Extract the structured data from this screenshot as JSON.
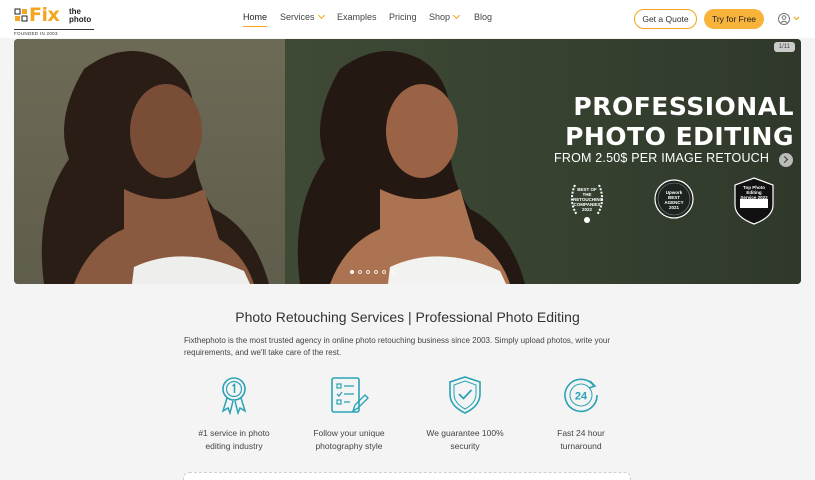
{
  "logo": {
    "fix": "Fix",
    "the": "the",
    "photo": "photo",
    "founded": "FOUNDED IN 2003"
  },
  "nav": [
    {
      "label": "Home",
      "dropdown": false
    },
    {
      "label": "Services",
      "dropdown": true
    },
    {
      "label": "Examples",
      "dropdown": false
    },
    {
      "label": "Pricing",
      "dropdown": false
    },
    {
      "label": "Shop",
      "dropdown": true
    },
    {
      "label": "Blog",
      "dropdown": false
    }
  ],
  "header": {
    "quote_label": "Get a Quote",
    "try_label": "Try for Free"
  },
  "hero": {
    "counter": "1/11",
    "title_line1": "PROFESSIONAL",
    "title_line2": "PHOTO EDITING",
    "subtitle": "FROM 2.50$ PER IMAGE RETOUCH",
    "badges": [
      {
        "text": "BEST OF THE RETOUCHING COMPANIES 2022",
        "icon": "laurel-badge-icon"
      },
      {
        "text": "Upwork BEST AGENCY 2021",
        "icon": "upwork-badge-icon"
      },
      {
        "text": "Top Photo Editing Service 2022",
        "icon": "shield-badge-icon"
      }
    ],
    "slides": 6,
    "active_slide": 0
  },
  "content": {
    "title": "Photo Retouching Services | Professional Photo Editing",
    "description": "Fixthephoto is the most trusted agency in online photo retouching business since 2003. Simply upload photos, write your requirements, and we'll take care of the rest."
  },
  "features": [
    {
      "line1": "#1 service in photo",
      "line2": "editing industry",
      "icon": "award-ribbon-icon"
    },
    {
      "line1": "Follow your unique",
      "line2": "photography style",
      "icon": "checklist-icon"
    },
    {
      "line1": "We guarantee 100%",
      "line2": "security",
      "icon": "shield-check-icon"
    },
    {
      "line1": "Fast 24 hour",
      "line2": "turnaround",
      "icon": "clock-24-icon"
    }
  ],
  "colors": {
    "accent": "#f5a41d",
    "icon_teal": "#2aa3b5"
  }
}
